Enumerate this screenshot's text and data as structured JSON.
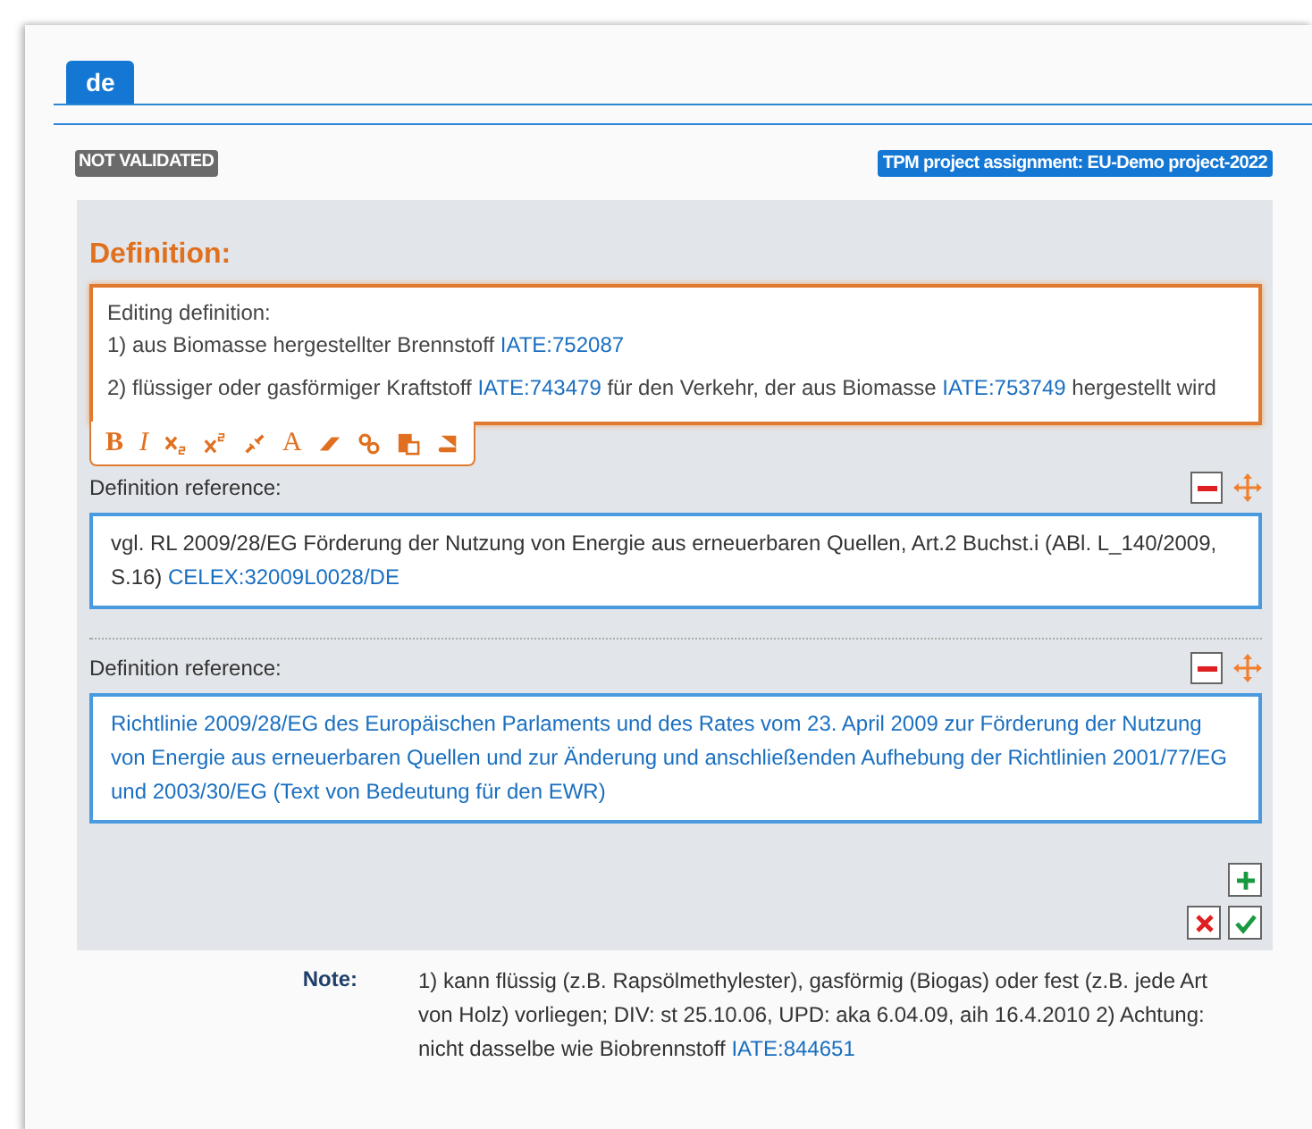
{
  "tabs": [
    {
      "label": "de",
      "selected": true
    }
  ],
  "status_badge": "NOT VALIDATED",
  "project_badge": "TPM project assignment: EU-Demo project-2022",
  "definition": {
    "heading": "Definition:",
    "editor_lines": [
      [
        {
          "kind": "text",
          "text": "Editing definition:"
        }
      ],
      [
        {
          "kind": "text",
          "text": "1) aus Biomasse hergestellter Brennstoff "
        },
        {
          "kind": "link",
          "text": "IATE:752087"
        }
      ],
      [
        {
          "kind": "text",
          "text": "2) flüssiger oder gasförmiger Kraftstoff "
        },
        {
          "kind": "link",
          "text": "IATE:743479"
        },
        {
          "kind": "text",
          "text": " für den Verkehr, der aus Biomasse "
        },
        {
          "kind": "link",
          "text": "IATE:753749"
        },
        {
          "kind": "text",
          "text": " hergestellt wird"
        }
      ]
    ],
    "toolbar": [
      {
        "kind": "bold",
        "label": "B"
      },
      {
        "kind": "italic",
        "label": "I"
      },
      {
        "kind": "subscript"
      },
      {
        "kind": "superscript"
      },
      {
        "kind": "unlink"
      },
      {
        "kind": "font",
        "label": "A"
      },
      {
        "kind": "eraser"
      },
      {
        "kind": "link"
      },
      {
        "kind": "paste"
      },
      {
        "kind": "book"
      }
    ]
  },
  "references": [
    {
      "label": "Definition reference:",
      "parts": [
        {
          "kind": "text",
          "text": "vgl. RL 2009/28/EG Förderung der Nutzung von Energie aus erneuerbaren Quellen, Art.2 Buchst.i (ABl. L_140/2009, S.16) "
        },
        {
          "kind": "link",
          "text": "CELEX:32009L0028/DE"
        }
      ]
    },
    {
      "label": "Definition reference:",
      "parts": [
        {
          "kind": "link",
          "text": "Richtlinie 2009/28/EG des Europäischen Parlaments und des Rates vom 23. April 2009 zur Förderung der Nutzung von Energie aus erneuerbaren Quellen und zur Änderung und anschließenden Aufhebung der Richtlinien 2001/77/EG und 2003/30/EG (Text von Bedeutung für den EWR)"
        }
      ]
    }
  ],
  "note": {
    "label": "Note:",
    "parts": [
      {
        "kind": "text",
        "text": "1) kann flüssig (z.B. Rapsölmethylester), gasförmig (Biogas) oder fest (z.B. jede Art von Holz) vorliegen; DIV: st 25.10.06, UPD: aka 6.04.09, aih 16.4.2010 2) Achtung: nicht dasselbe wie Biobrennstoff "
      },
      {
        "kind": "link",
        "text": "IATE:844651"
      }
    ]
  }
}
